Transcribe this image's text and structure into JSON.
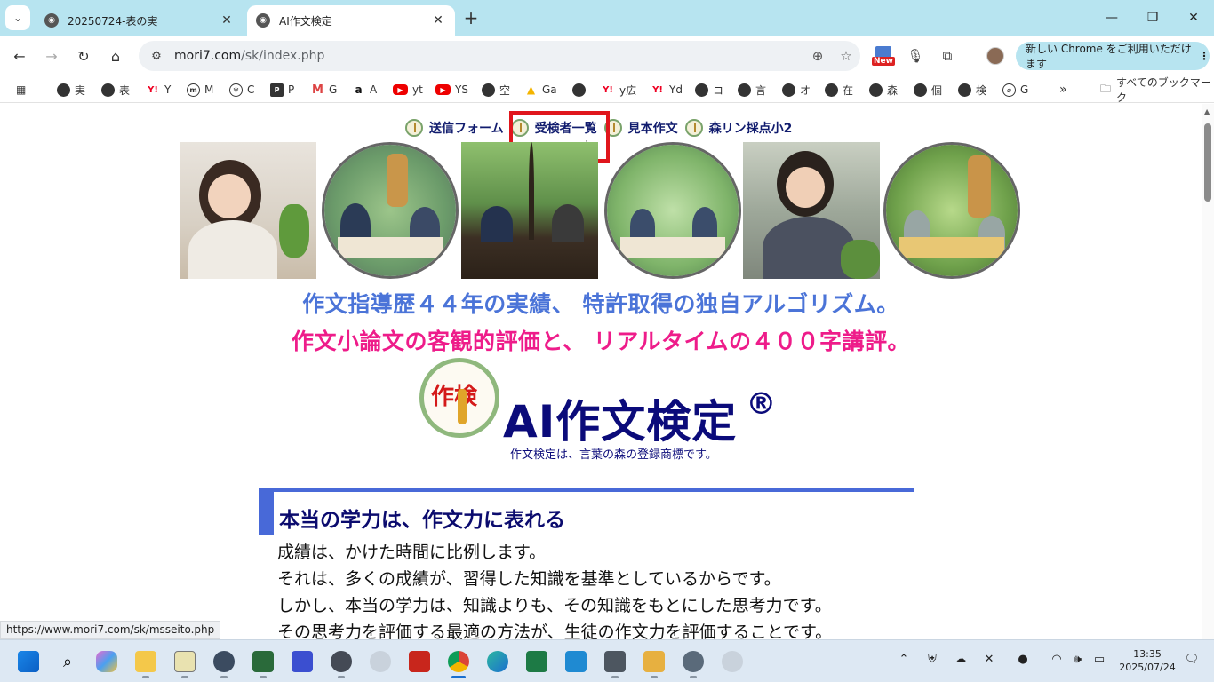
{
  "browser": {
    "tabs": [
      {
        "title": "20250724-表の実",
        "active": false
      },
      {
        "title": "AI作文検定",
        "active": true
      }
    ],
    "url_host": "mori7.com",
    "url_path": "/sk/index.php",
    "update_label": "新しい Chrome をご利用いただけます",
    "new_badge": "New",
    "bookmarks": [
      {
        "label": "実",
        "icon": "globe-icon"
      },
      {
        "label": "表",
        "icon": "globe-icon"
      },
      {
        "label": "Y",
        "icon": "yahoo-icon"
      },
      {
        "label": "M",
        "icon": "m-icon"
      },
      {
        "label": "C",
        "icon": "chatgpt-icon"
      },
      {
        "label": "P",
        "icon": "p-icon"
      },
      {
        "label": "G",
        "icon": "gmail-icon"
      },
      {
        "label": "A",
        "icon": "amazon-icon"
      },
      {
        "label": "yt",
        "icon": "youtube-icon"
      },
      {
        "label": "YS",
        "icon": "youtube-icon"
      },
      {
        "label": "空",
        "icon": "globe-icon"
      },
      {
        "label": "Ga",
        "icon": "google-drive-icon"
      },
      {
        "label": "",
        "icon": "globe-icon"
      },
      {
        "label": "y広",
        "icon": "yahoo-icon"
      },
      {
        "label": "Yd",
        "icon": "yahoo-icon"
      },
      {
        "label": "コ",
        "icon": "globe-icon"
      },
      {
        "label": "言",
        "icon": "globe-icon"
      },
      {
        "label": "オ",
        "icon": "globe-icon"
      },
      {
        "label": "在",
        "icon": "globe-icon"
      },
      {
        "label": "森",
        "icon": "globe-icon"
      },
      {
        "label": "個",
        "icon": "globe-icon"
      },
      {
        "label": "検",
        "icon": "globe-icon"
      },
      {
        "label": "G",
        "icon": "link-icon"
      }
    ],
    "all_bookmarks_label": "すべてのブックマーク",
    "status_url": "https://www.mori7.com/sk/msseito.php"
  },
  "page": {
    "nav": [
      {
        "label": "送信フォーム"
      },
      {
        "label": "受検者一覧"
      },
      {
        "label": "見本作文"
      },
      {
        "label": "森リン採点小2"
      }
    ],
    "tagline1": "作文指導歴４４年の実績、 特許取得の独自アルゴリズム。",
    "tagline2": "作文小論文の客観的評価と、 リアルタイムの４００字講評。",
    "logo_text": "作検",
    "brand": "AI作文検定",
    "brand_mark": "®",
    "trademark_note": "作文検定は、言葉の森の登録商標です。",
    "section_heading": "本当の学力は、作文力に表れる",
    "body": [
      "成績は、かけた時間に比例します。",
      "それは、多くの成績が、習得した知識を基準としているからです。",
      "しかし、本当の学力は、知識よりも、その知識をもとにした思考力です。",
      "その思考力を評価する最適の方法が、生徒の作文力を評価することです。"
    ]
  },
  "taskbar": {
    "time": "13:35",
    "date": "2025/07/24"
  }
}
